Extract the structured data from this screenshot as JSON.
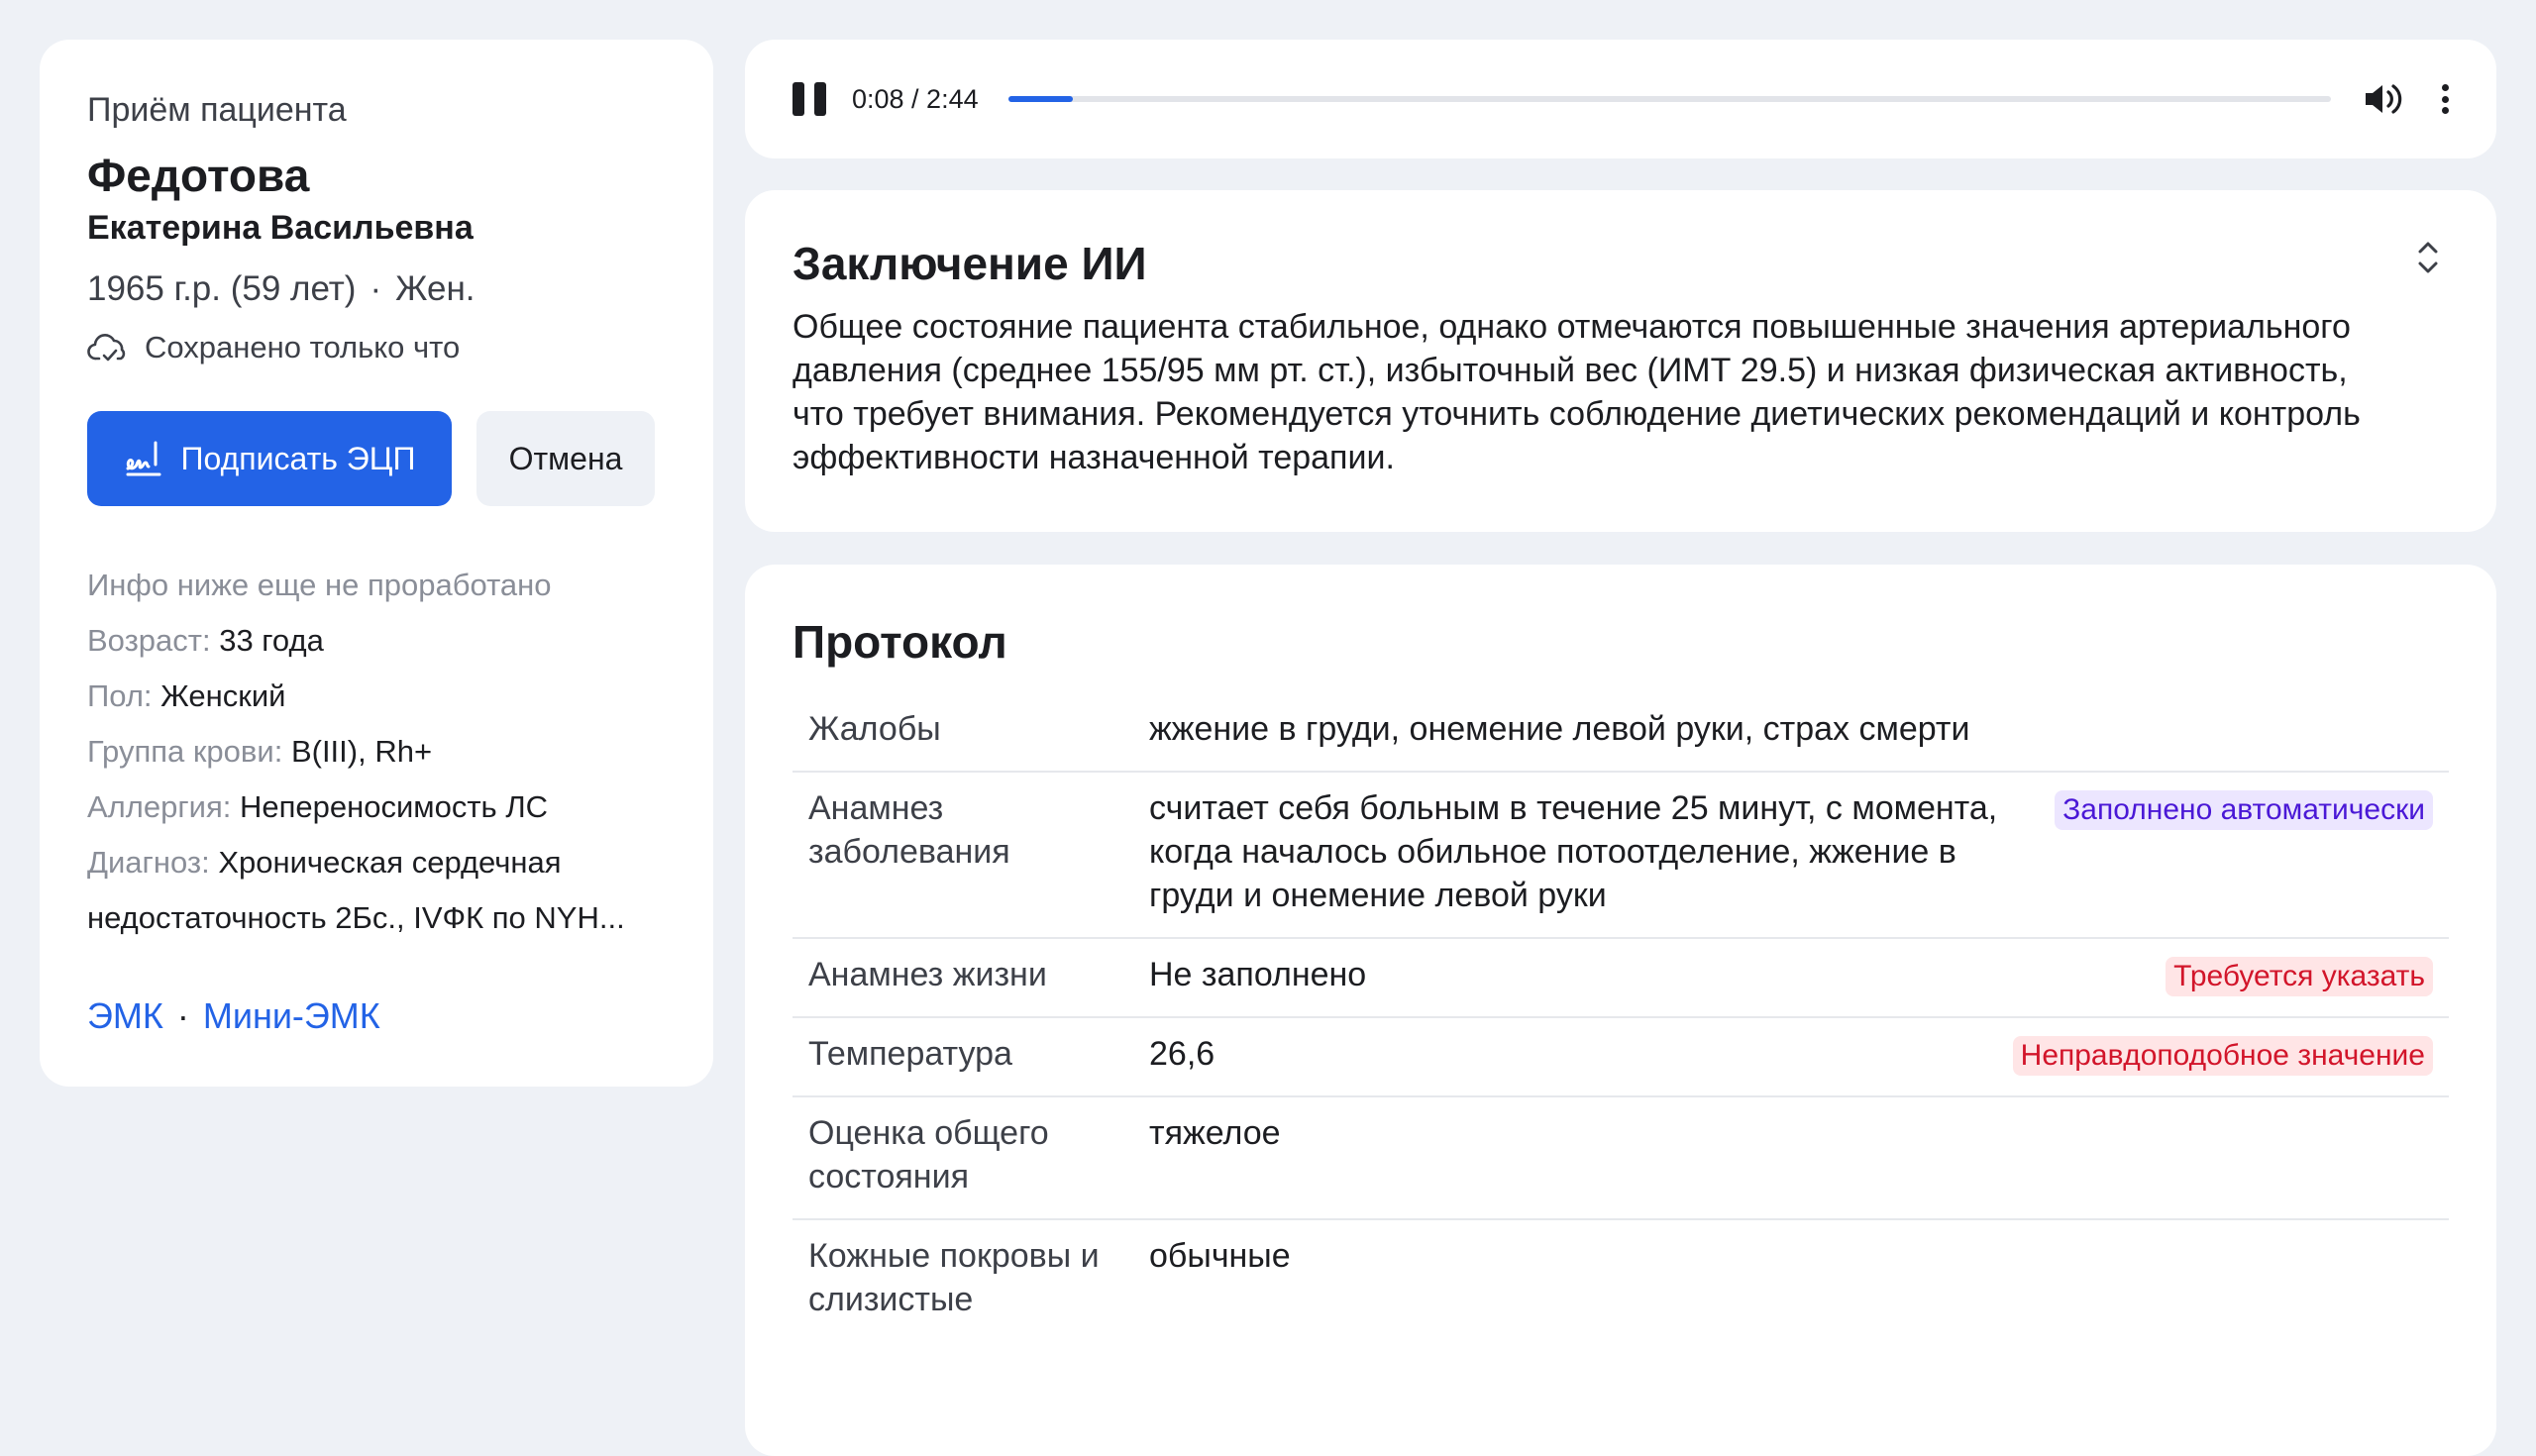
{
  "patient": {
    "header": "Приём пациента",
    "surname": "Федотова",
    "given_names": "Екатерина Васильевна",
    "birth": "1965 г.р. (59 лет)",
    "gender_short": "Жен.",
    "dot": "·",
    "saved_status": "Сохранено только что",
    "sign_button": "Подписать ЭЦП",
    "cancel_button": "Отмена",
    "info_note": "Инфо ниже еще не проработано",
    "info": [
      {
        "label": "Возраст:",
        "value": "33 года"
      },
      {
        "label": "Пол:",
        "value": "Женский"
      },
      {
        "label": "Группа крови:",
        "value": "B(III), Rh+"
      },
      {
        "label": "Аллергия:",
        "value": "Непереносимость ЛС"
      },
      {
        "label": "Диагноз:",
        "value": "Хроническая сердечная недостаточность 2Бс., IVФК по NYH..."
      }
    ],
    "link_emk": "ЭМК",
    "link_mini_emk": "Мини-ЭМК"
  },
  "player": {
    "time": "0:08 / 2:44",
    "progress": 0.049
  },
  "ai": {
    "title": "Заключение ИИ",
    "text": "Общее состояние пациента стабильное, однако отмечаются повышенные значения артериального давления (среднее 155/95 мм рт. ст.), избыточный вес (ИМТ 29.5) и низкая физическая активность, что требует внимания. Рекомендуется уточнить соблюдение диетических рекомендаций и контроль эффективности назначенной терапии."
  },
  "protocol": {
    "title": "Протокол",
    "rows": [
      {
        "label": "Жалобы",
        "value": "жжение в груди, онемение левой руки, страх смерти",
        "badge": ""
      },
      {
        "label": "Анамнез заболевания",
        "value": "считает себя больным в течение 25 минут, с момента, когда началось обильное потоотделение, жжение в груди и онемение левой руки",
        "badge": "Заполнено автоматически"
      },
      {
        "label": "Анамнез жизни",
        "value": "Не заполнено",
        "badge": "Требуется указать"
      },
      {
        "label": "Температура",
        "value": "26,6",
        "badge": "Неправдоподобное значение"
      },
      {
        "label": "Оценка общего состояния",
        "value": "тяжелое",
        "badge": ""
      },
      {
        "label": "Кожные покровы и слизистые",
        "value": "обычные",
        "badge": ""
      }
    ]
  },
  "colors": {
    "accent": "#2363e6",
    "auto_badge_bg": "#ece6ff",
    "auto_badge_text": "#4a18d6",
    "warn_badge_bg": "#ffe5e6",
    "warn_badge_text": "#d2152a"
  },
  "icons": {
    "saved": "cloud-check-icon",
    "sign": "signature-icon",
    "play_state": "pause-icon",
    "volume": "volume-icon",
    "menu": "more-vertical-icon",
    "collapse": "chevron-up-down-icon"
  }
}
